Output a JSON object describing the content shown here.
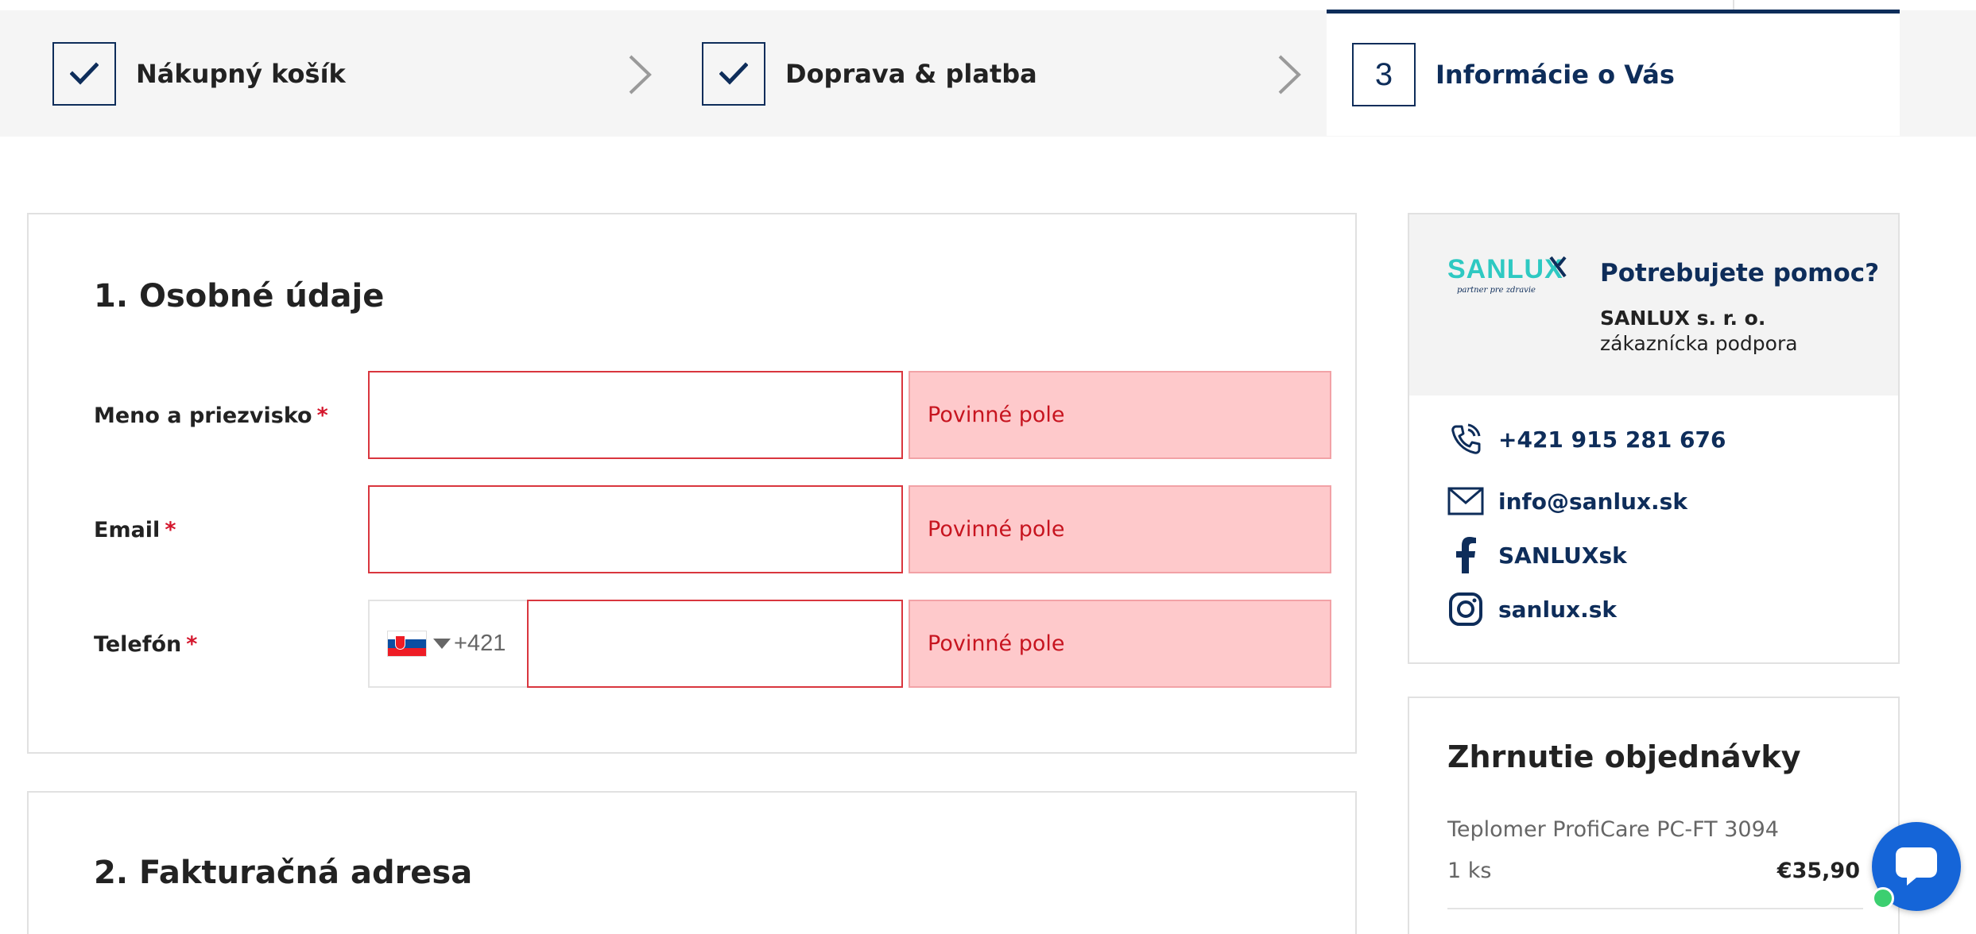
{
  "steps": [
    {
      "label": "Nákupný košík",
      "state": "done"
    },
    {
      "label": "Doprava & platba",
      "state": "done"
    },
    {
      "label": "Informácie o Vás",
      "number": "3",
      "state": "active"
    }
  ],
  "personal": {
    "title": "1. Osobné údaje",
    "required_mark": "*",
    "fields": {
      "name": {
        "label": "Meno a priezvisko",
        "value": "",
        "error": "Povinné pole"
      },
      "email": {
        "label": "Email",
        "value": "",
        "error": "Povinné pole"
      },
      "phone": {
        "label": "Telefón",
        "prefix": "+421",
        "value": "",
        "error": "Povinné pole"
      }
    }
  },
  "billing": {
    "title": "2. Fakturačná adresa"
  },
  "help": {
    "logo_text": "SANLUX",
    "logo_tagline": "partner pre zdravie",
    "title": "Potrebujete pomoc?",
    "company": "SANLUX s. r. o.",
    "subtitle": "zákaznícka podpora",
    "contacts": {
      "phone": "+421 915 281 676",
      "email": "info@sanlux.sk",
      "facebook": "SANLUXsk",
      "instagram": "sanlux.sk"
    }
  },
  "summary": {
    "title": "Zhrnutie objednávky",
    "item": "Teplomer ProfiCare PC-FT 3094",
    "qty": "1 ks",
    "price": "€35,90"
  },
  "colors": {
    "primary": "#0e2d5a",
    "error_bg": "#fec9cb",
    "error_text": "#c7141f",
    "logo_teal": "#2ec9c2",
    "chat": "#1565d8"
  }
}
